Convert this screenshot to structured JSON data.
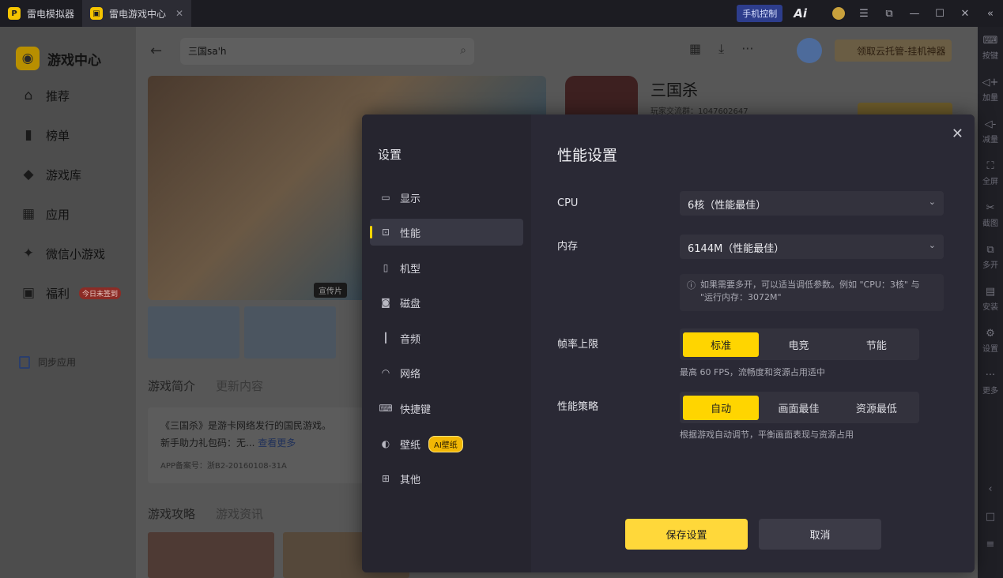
{
  "titlebar": {
    "tab1": "雷电模拟器",
    "tab2": "雷电游戏中心",
    "phone_control": "手机控制",
    "ai_label": "Ai"
  },
  "leftnav": {
    "brand": "游戏中心",
    "items": [
      {
        "label": "推荐",
        "icon": "home-icon"
      },
      {
        "label": "榜单",
        "icon": "chart-icon"
      },
      {
        "label": "游戏库",
        "icon": "gamepad-icon"
      },
      {
        "label": "应用",
        "icon": "apps-icon"
      },
      {
        "label": "微信小游戏",
        "icon": "mini-game-icon"
      },
      {
        "label": "福利",
        "icon": "gift-icon",
        "badge": "今日未签到"
      }
    ],
    "sync": "同步应用"
  },
  "main": {
    "search_value": "三国sa'h",
    "cloud_button": "领取云托管-挂机神器",
    "banner_tag": "宣传片",
    "tabs1": [
      "游戏简介",
      "更新内容"
    ],
    "intro_line1": "《三国杀》是游卡网络发行的国民游戏。",
    "intro_line2": "新手助力礼包码：无...",
    "intro_more": "查看更多",
    "intro_record": "APP备案号：浙B2-20160108-31A",
    "tabs2": [
      "游戏攻略",
      "游戏资讯"
    ],
    "game_title": "三国杀",
    "game_sub": "玩家交流群：1047602647"
  },
  "rightbar": {
    "items": [
      "按键",
      "加量",
      "减量",
      "全屏",
      "截图",
      "多开",
      "安装",
      "设置",
      "更多"
    ]
  },
  "modal": {
    "side_title": "设置",
    "side_items": [
      {
        "label": "显示",
        "icon": "monitor-icon"
      },
      {
        "label": "性能",
        "icon": "performance-icon"
      },
      {
        "label": "机型",
        "icon": "phone-icon"
      },
      {
        "label": "磁盘",
        "icon": "disk-icon"
      },
      {
        "label": "音频",
        "icon": "audio-icon"
      },
      {
        "label": "网络",
        "icon": "wifi-icon"
      },
      {
        "label": "快捷键",
        "icon": "keyboard-icon"
      },
      {
        "label": "壁纸",
        "icon": "palette-icon",
        "tag": "AI壁纸"
      },
      {
        "label": "其他",
        "icon": "grid-icon"
      }
    ],
    "active_item": "性能",
    "title": "性能设置",
    "cpu_label": "CPU",
    "cpu_value": "6核（性能最佳）",
    "mem_label": "内存",
    "mem_value": "6144M（性能最佳）",
    "hint_line1": "如果需要多开，可以适当调低参数。例如 \"CPU：3核\" 与",
    "hint_line2": "\"运行内存：3072M\"",
    "fps_label": "帧率上限",
    "fps_options": [
      "标准",
      "电竞",
      "节能"
    ],
    "fps_selected": "标准",
    "fps_note": "最高 60 FPS，流畅度和资源占用适中",
    "strategy_label": "性能策略",
    "strategy_options": [
      "自动",
      "画面最佳",
      "资源最低"
    ],
    "strategy_selected": "自动",
    "strategy_note": "根据游戏自动调节，平衡画面表现与资源占用",
    "save": "保存设置",
    "cancel": "取消"
  },
  "colors": {
    "accent": "#ffd500",
    "modal_bg": "#262530",
    "titlebar_bg": "#1c1c22"
  }
}
